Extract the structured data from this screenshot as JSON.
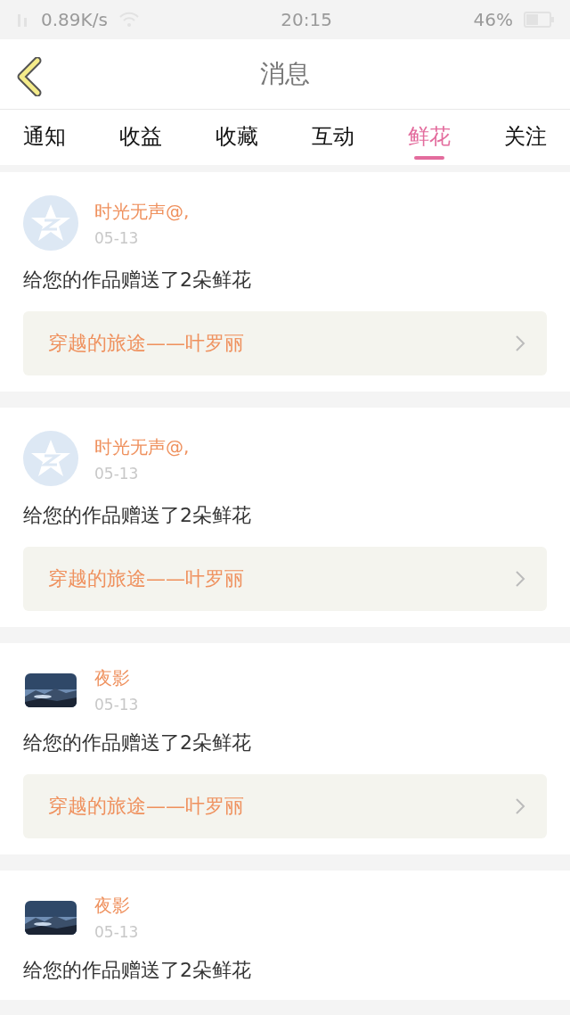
{
  "status_bar": {
    "speed": "0.89K/s",
    "time": "20:15",
    "battery": "46%"
  },
  "header": {
    "title": "消息"
  },
  "tabs": [
    {
      "label": "通知",
      "selected": false
    },
    {
      "label": "收益",
      "selected": false
    },
    {
      "label": "收藏",
      "selected": false
    },
    {
      "label": "互动",
      "selected": false
    },
    {
      "label": "鲜花",
      "selected": true
    },
    {
      "label": "关注",
      "selected": false
    }
  ],
  "messages": [
    {
      "avatar": {
        "kind": "default"
      },
      "user": "时光无声@,",
      "date": "05-13",
      "text": "给您的作品赠送了2朵鲜花",
      "work": "穿越的旅途——叶罗丽"
    },
    {
      "avatar": {
        "kind": "default"
      },
      "user": "时光无声@,",
      "date": "05-13",
      "text": "给您的作品赠送了2朵鲜花",
      "work": "穿越的旅途——叶罗丽"
    },
    {
      "user": "夜影",
      "date": "05-13",
      "text": "给您的作品赠送了2朵鲜花",
      "work": "穿越的旅途——叶罗丽"
    },
    {
      "user": "夜影",
      "date": "05-13",
      "text": "给您的作品赠送了2朵鲜花"
    }
  ]
}
